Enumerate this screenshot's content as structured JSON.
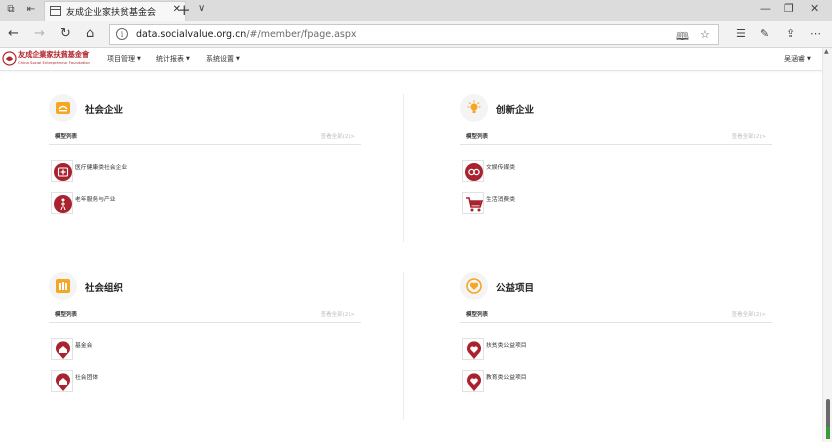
{
  "browser": {
    "tab_title": "友成企业家扶贫基金会",
    "url_host": "data.socialvalue.org.cn",
    "url_path": "/#/member/fpage.aspx"
  },
  "site": {
    "logo_cn": "友成企業家扶貧基金會",
    "logo_en": "China Social Entrepreneur Foundation",
    "menu": [
      "项目管理",
      "统计报表",
      "系统设置"
    ],
    "user": "吴涵睿"
  },
  "sections": [
    {
      "title": "社会企业",
      "list_label": "模型列表",
      "view_all": "查看全部(2)>",
      "icon": "social-enterprise-icon",
      "items": [
        {
          "label": "医疗健康类社会企业",
          "icon": "medical-cross-icon"
        },
        {
          "label": "老年服务与产业",
          "icon": "elderly-service-icon"
        }
      ]
    },
    {
      "title": "创新企业",
      "list_label": "模型列表",
      "view_all": "查看全部(2)>",
      "icon": "lightbulb-icon",
      "items": [
        {
          "label": "文娱传媒类",
          "icon": "media-link-icon"
        },
        {
          "label": "生活消费类",
          "icon": "shopping-cart-icon"
        }
      ]
    },
    {
      "title": "社会组织",
      "list_label": "模型列表",
      "view_all": "查看全部(2)>",
      "icon": "organization-icon",
      "items": [
        {
          "label": "基金会",
          "icon": "home-pin-icon"
        },
        {
          "label": "社会团体",
          "icon": "home-pin-icon"
        }
      ]
    },
    {
      "title": "公益项目",
      "list_label": "模型列表",
      "view_all": "查看全部(2)>",
      "icon": "charity-heart-icon",
      "items": [
        {
          "label": "扶贫类公益项目",
          "icon": "heart-pin-icon"
        },
        {
          "label": "教育类公益项目",
          "icon": "heart-pin-icon"
        }
      ]
    }
  ],
  "colors": {
    "accent_orange": "#f5a623",
    "item_red": "#a8232f",
    "brand_red": "#b2262b"
  }
}
